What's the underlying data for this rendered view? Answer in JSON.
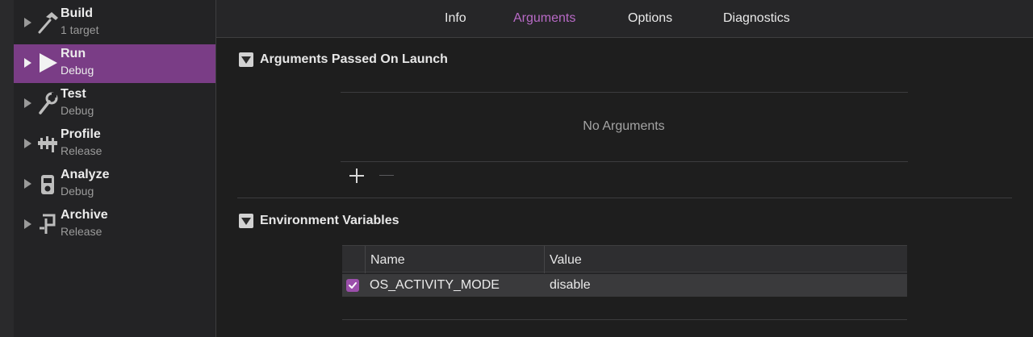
{
  "sidebar": {
    "items": [
      {
        "name": "Build",
        "sub": "1 target",
        "icon": "hammer-icon",
        "selected": false
      },
      {
        "name": "Run",
        "sub": "Debug",
        "icon": "play-icon",
        "selected": true
      },
      {
        "name": "Test",
        "sub": "Debug",
        "icon": "wrench-icon",
        "selected": false
      },
      {
        "name": "Profile",
        "sub": "Release",
        "icon": "gauge-icon",
        "selected": false
      },
      {
        "name": "Analyze",
        "sub": "Debug",
        "icon": "analyze-icon",
        "selected": false
      },
      {
        "name": "Archive",
        "sub": "Release",
        "icon": "archive-icon",
        "selected": false
      }
    ]
  },
  "tabs": {
    "items": [
      "Info",
      "Arguments",
      "Options",
      "Diagnostics"
    ],
    "active": "Arguments"
  },
  "arguments": {
    "title": "Arguments Passed On Launch",
    "empty_text": "No Arguments"
  },
  "environment": {
    "title": "Environment Variables",
    "columns": {
      "name": "Name",
      "value": "Value"
    },
    "rows": [
      {
        "enabled": true,
        "name": "OS_ACTIVITY_MODE",
        "value": "disable"
      }
    ]
  },
  "colors": {
    "accent": "#b86ac6",
    "selection": "#7a3d86",
    "checkbox": "#9b4fab",
    "background": "#1e1e1e"
  }
}
